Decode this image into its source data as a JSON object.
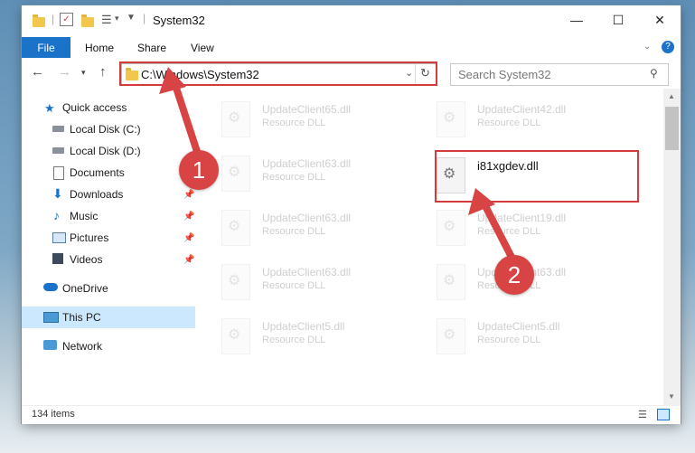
{
  "window": {
    "title": "System32",
    "controls": {
      "minimize": "—",
      "maximize": "☐",
      "close": "✕"
    }
  },
  "ribbon": {
    "tabs": [
      "File",
      "Home",
      "Share",
      "View"
    ]
  },
  "nav": {
    "address": "C:\\Windows\\System32",
    "search_placeholder": "Search System32"
  },
  "sidebar": {
    "items": [
      {
        "label": "Quick access",
        "icon": "star-icon"
      },
      {
        "label": "Local Disk (C:)",
        "icon": "drive-icon"
      },
      {
        "label": "Local Disk (D:)",
        "icon": "drive-icon"
      },
      {
        "label": "Documents",
        "icon": "documents-icon"
      },
      {
        "label": "Downloads",
        "icon": "download-icon"
      },
      {
        "label": "Music",
        "icon": "music-icon"
      },
      {
        "label": "Pictures",
        "icon": "pictures-icon"
      },
      {
        "label": "Videos",
        "icon": "videos-icon"
      },
      {
        "label": "OneDrive",
        "icon": "cloud-icon"
      },
      {
        "label": "This PC",
        "icon": "computer-icon"
      },
      {
        "label": "Network",
        "icon": "network-icon"
      }
    ]
  },
  "files": [
    {
      "name": "UpdateClient65.dll",
      "type": "Resource DLL"
    },
    {
      "name": "UpdateClient42.dll",
      "type": "Resource DLL"
    },
    {
      "name": "UpdateClient63.dll",
      "type": "Resource DLL"
    },
    {
      "name": "i81xgdev.dll",
      "type": ""
    },
    {
      "name": "UpdateClient63.dll",
      "type": "Resource DLL"
    },
    {
      "name": "UpdateClient19.dll",
      "type": "Resource DLL"
    },
    {
      "name": "UpdateClient63.dll",
      "type": "Resource DLL"
    },
    {
      "name": "UpdateClient63.dll",
      "type": "Resource DLL"
    },
    {
      "name": "UpdateClient5.dll",
      "type": "Resource DLL"
    },
    {
      "name": "UpdateClient5.dll",
      "type": "Resource DLL"
    }
  ],
  "status": {
    "item_count": "134 items"
  },
  "markers": {
    "one": "1",
    "two": "2"
  },
  "colors": {
    "accent": "#1a73c9",
    "highlight": "#d43c3c",
    "selected": "#cce8ff"
  }
}
